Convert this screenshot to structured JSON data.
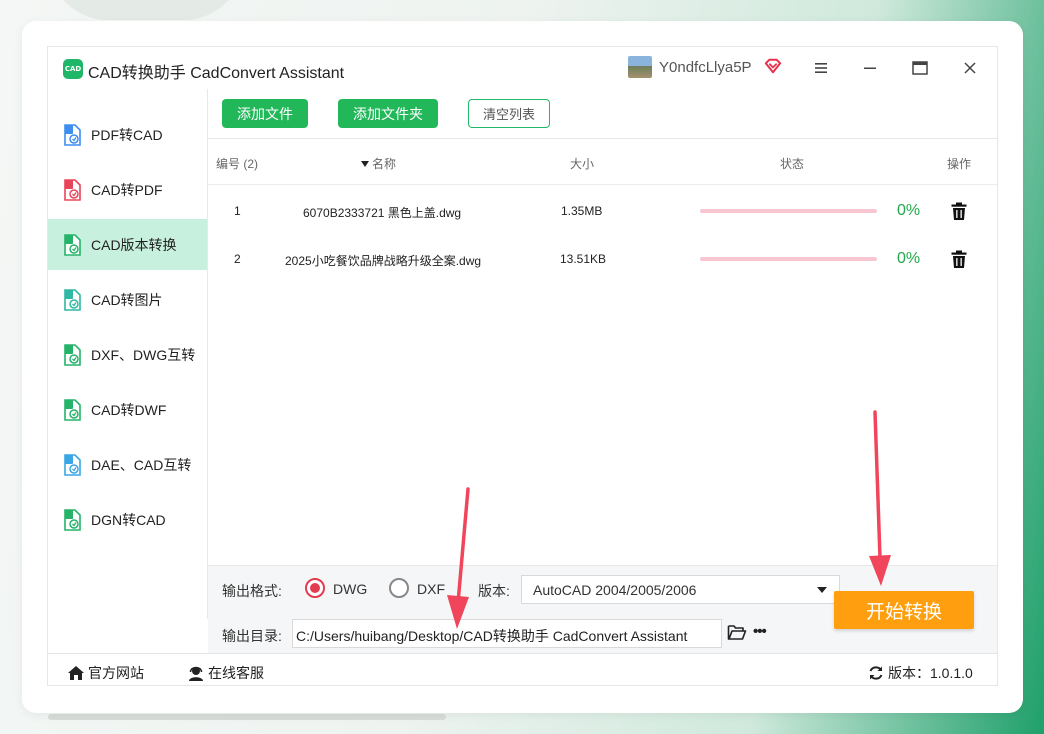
{
  "app": {
    "logo_text": "CAD",
    "title": "CAD转换助手 CadConvert Assistant",
    "username": "Y0ndfcLlya5P"
  },
  "sidebar": {
    "items": [
      {
        "label": "PDF转CAD",
        "active": false,
        "icon_color": "#3d8ef0"
      },
      {
        "label": "CAD转PDF",
        "active": false,
        "icon_color": "#e8455a"
      },
      {
        "label": "CAD版本转换",
        "active": true,
        "icon_color": "#25b36a"
      },
      {
        "label": "CAD转图片",
        "active": false,
        "icon_color": "#2fb8a3"
      },
      {
        "label": "DXF、DWG互转",
        "active": false,
        "icon_color": "#25b36a"
      },
      {
        "label": "CAD转DWF",
        "active": false,
        "icon_color": "#25b36a"
      },
      {
        "label": "DAE、CAD互转",
        "active": false,
        "icon_color": "#3aa6e6"
      },
      {
        "label": "DGN转CAD",
        "active": false,
        "icon_color": "#25b36a"
      }
    ]
  },
  "toolbar": {
    "add_file": "添加文件",
    "add_folder": "添加文件夹",
    "clear_list": "清空列表"
  },
  "table": {
    "headers": {
      "index": "编号 (2)",
      "name": "名称",
      "size": "大小",
      "status": "状态",
      "action": "操作"
    },
    "rows": [
      {
        "index": "1",
        "name": "6070B2333721 黑色上盖.dwg",
        "size": "1.35MB",
        "progress": 0,
        "percent": "0%"
      },
      {
        "index": "2",
        "name": "2025小吃餐饮品牌战略升级全案.dwg",
        "size": "13.51KB",
        "progress": 0,
        "percent": "0%"
      }
    ]
  },
  "options": {
    "format_label": "输出格式:",
    "format_dwg": "DWG",
    "format_dxf": "DXF",
    "selected_format": "DWG",
    "version_label": "版本:",
    "version_value": "AutoCAD 2004/2005/2006",
    "output_label": "输出目录:",
    "output_path": "C:/Users/huibang/Desktop/CAD转换助手 CadConvert Assistant",
    "more": "•••"
  },
  "start_button": "开始转换",
  "footer": {
    "website": "官方网站",
    "support": "在线客服",
    "version": "版本：1.0.1.0"
  },
  "colors": {
    "accent_green": "#22b85a",
    "active_bg": "#c8f0de",
    "start_orange": "#ff9f0f",
    "arrow_red": "#f0455a",
    "progress_track": "#f7c6d1"
  }
}
